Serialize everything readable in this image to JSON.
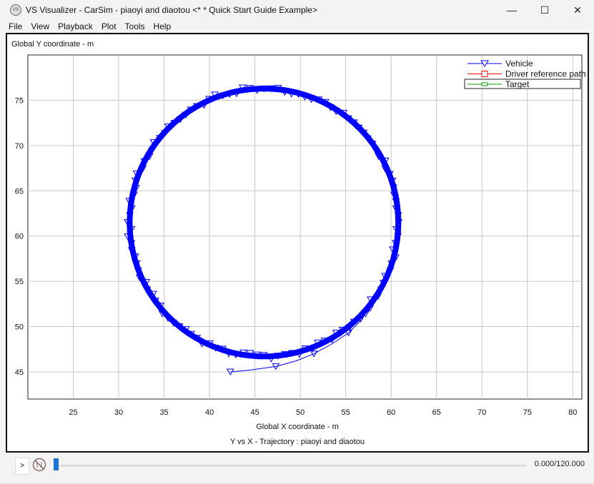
{
  "window": {
    "title": "VS Visualizer - CarSim - piaoyi and diaotou <* * Quick Start Guide Example>",
    "controls": [
      "—",
      "☐",
      "✕"
    ]
  },
  "menu": [
    "File",
    "View",
    "Playback",
    "Plot",
    "Tools",
    "Help"
  ],
  "playback": {
    "play_label": ">",
    "time": "0.000/120.000",
    "progress": 0.0
  },
  "chart_data": {
    "type": "line",
    "title": "Y vs X - Trajectory : piaoyi and diaotou",
    "xlabel": "Global X coordinate - m",
    "ylabel": "Global Y coordinate - m",
    "xlim": [
      20,
      81
    ],
    "ylim": [
      42,
      80
    ],
    "xticks": [
      25,
      30,
      35,
      40,
      45,
      50,
      55,
      60,
      65,
      70,
      75,
      80
    ],
    "yticks": [
      45,
      50,
      55,
      60,
      65,
      70,
      75
    ],
    "grid": true,
    "legend_position": "top-right",
    "series": [
      {
        "name": "Vehicle",
        "color": "#0000ff",
        "marker": "triangle-down",
        "approach": [
          [
            42.3,
            45.0
          ],
          [
            44.5,
            45.2
          ],
          [
            47.3,
            45.6
          ],
          [
            49.5,
            46.2
          ],
          [
            51.5,
            47.0
          ],
          [
            53.5,
            48.1
          ],
          [
            55.3,
            49.3
          ],
          [
            56.9,
            50.9
          ]
        ],
        "circle": {
          "center": [
            46.0,
            61.5
          ],
          "radius_x": 14.8,
          "radius_y": 14.8
        }
      },
      {
        "name": "Driver reference path",
        "color": "#ff0000",
        "marker": "square",
        "points": []
      },
      {
        "name": "Target",
        "color": "#00a000",
        "marker": "square",
        "points": []
      }
    ]
  }
}
